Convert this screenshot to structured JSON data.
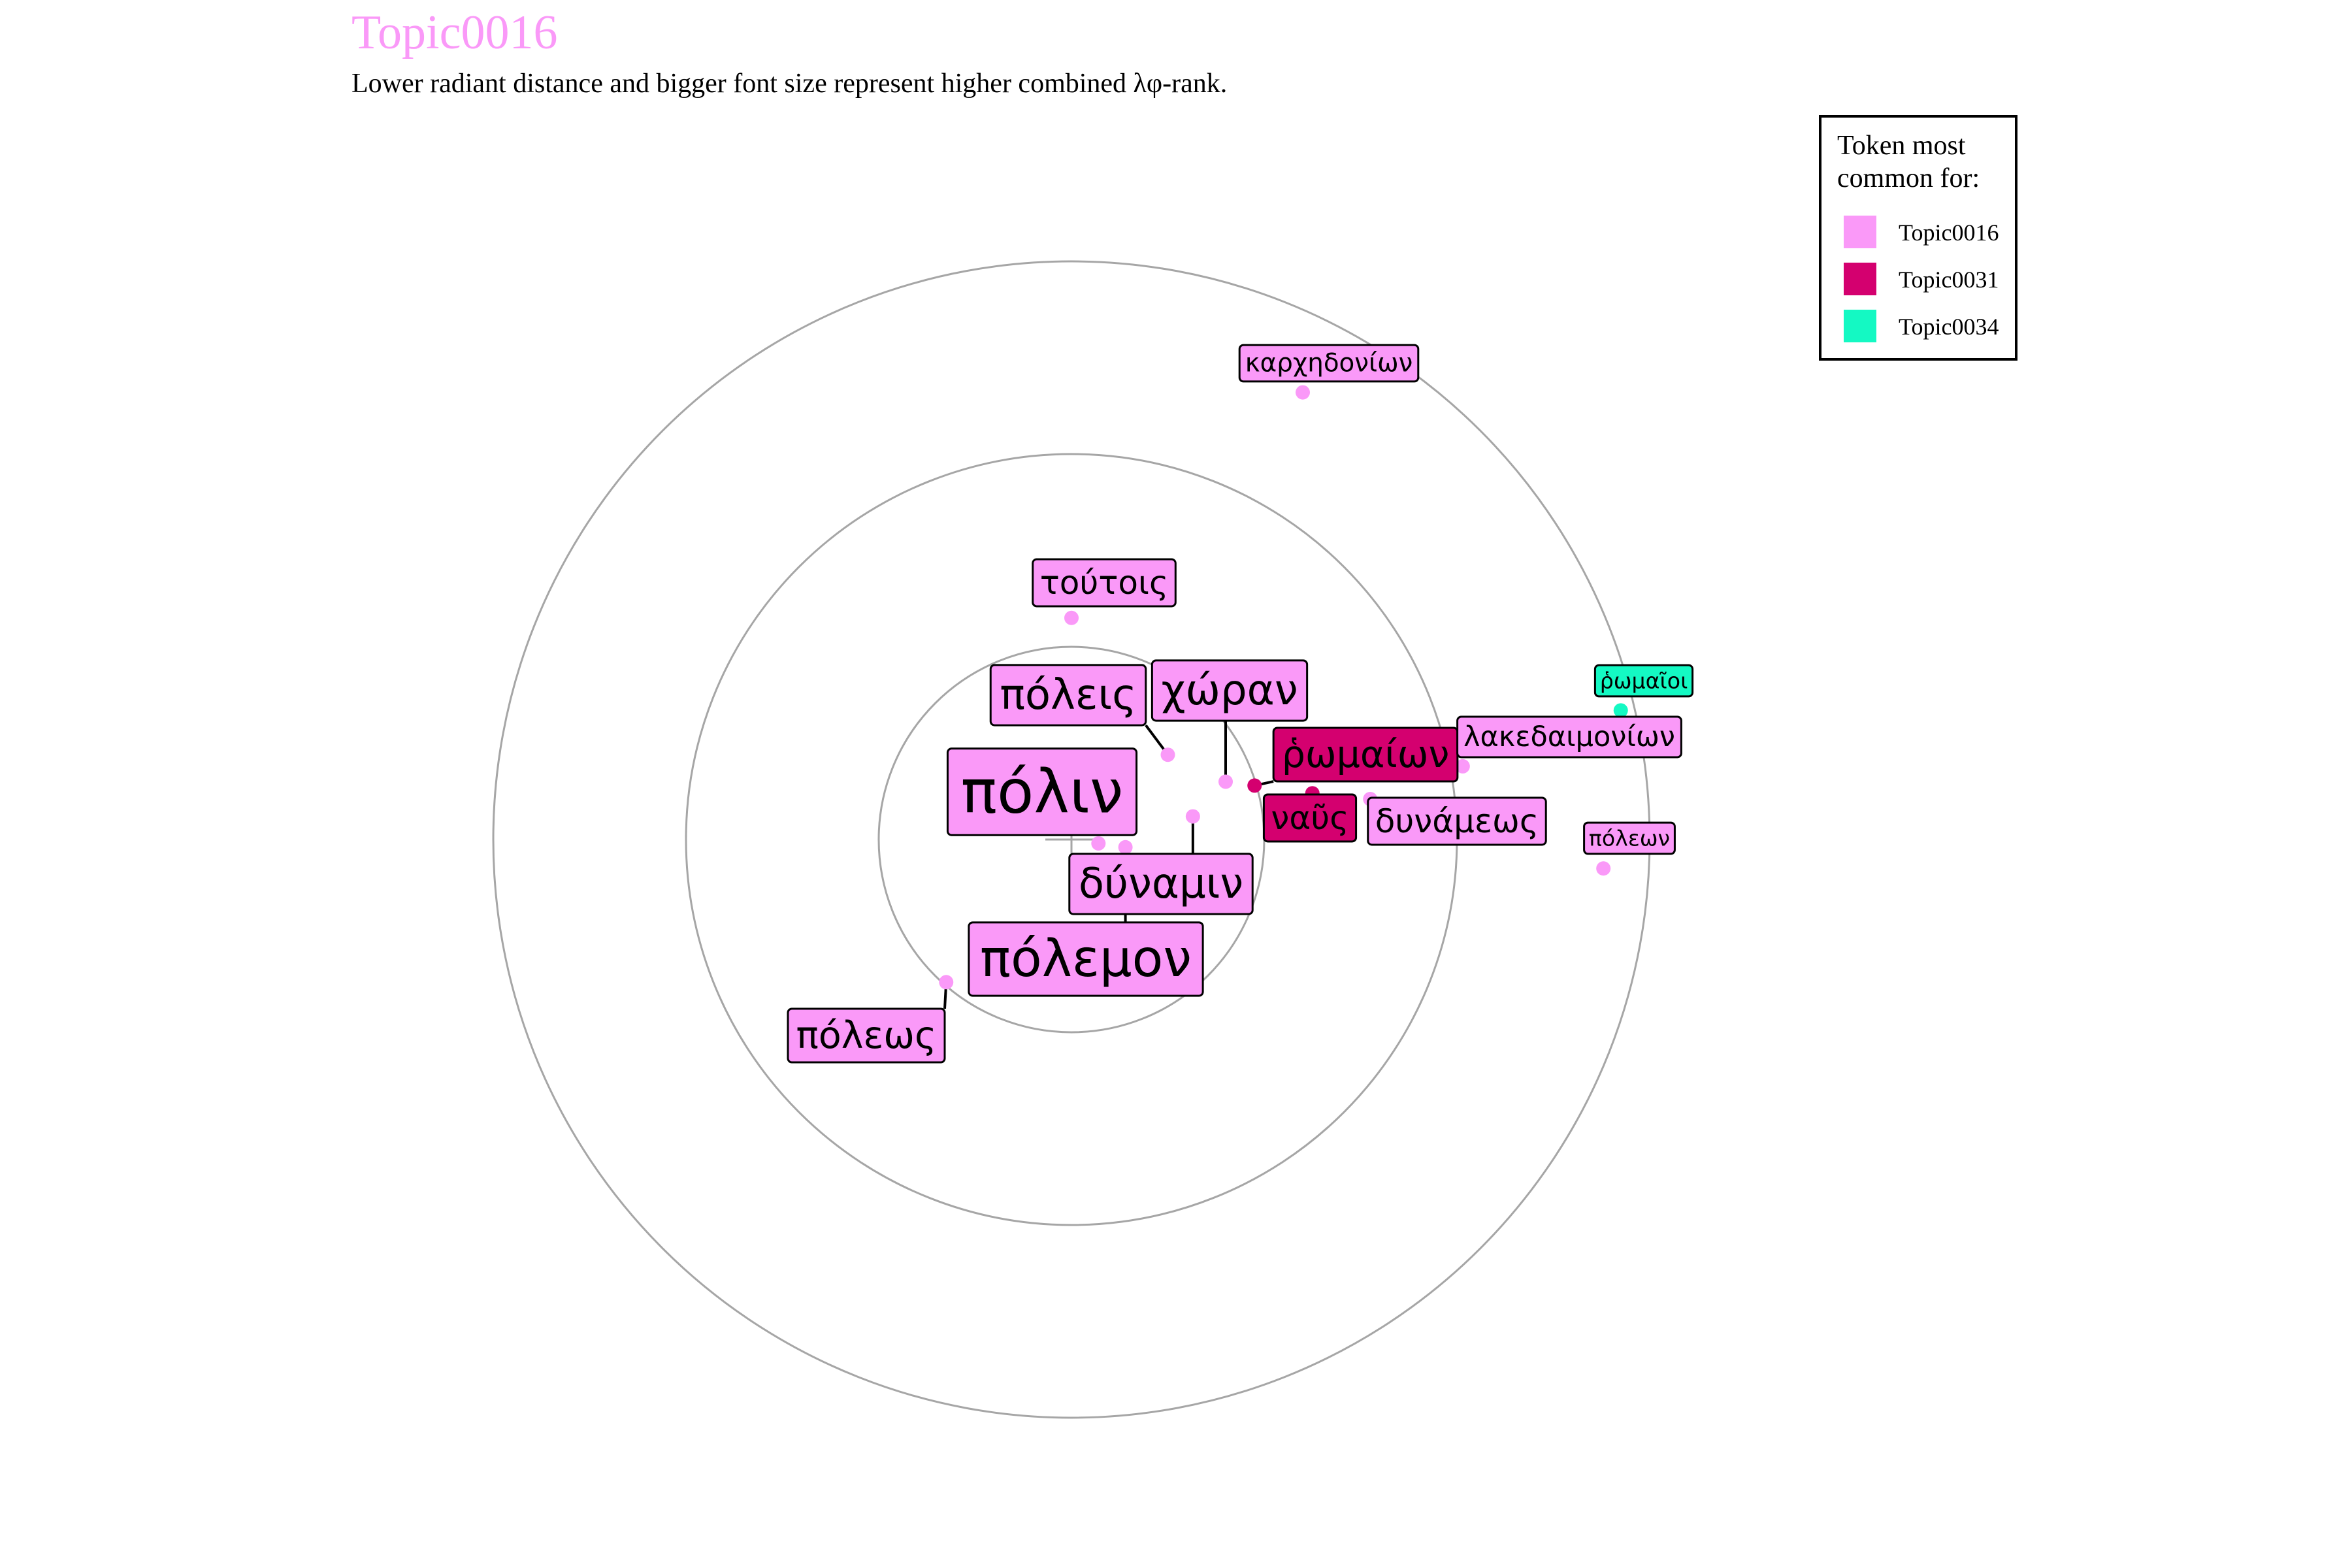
{
  "chart_data": {
    "type": "scatter",
    "title": "Topic0016",
    "subtitle": "Lower radiant distance and bigger font size represent higher combined λφ-rank.",
    "colors": {
      "Topic0016": "#FA99F8",
      "Topic0031": "#D4006F",
      "Topic0034": "#14F9C3",
      "title": "#FA99F8",
      "rings": "#A6A6A6",
      "center_cross": "#A6A6A6",
      "connector": "#000000",
      "label_border": "#000000"
    },
    "rings": [
      1,
      2,
      3
    ],
    "grid": true,
    "legend_position": "top-right",
    "legend": {
      "title": "Token most common for:",
      "entries": [
        {
          "label": "Topic0016",
          "color": "#FA99F8"
        },
        {
          "label": "Topic0031",
          "color": "#D4006F"
        },
        {
          "label": "Topic0034",
          "color": "#14F9C3"
        }
      ]
    },
    "points": [
      {
        "token": "πόλιν",
        "topic": "Topic0016",
        "x": 0.14,
        "y": -0.02,
        "label_size": 6
      },
      {
        "token": "πόλεμον",
        "topic": "Topic0016",
        "x": 0.28,
        "y": -0.04,
        "label_size": 5
      },
      {
        "token": "δύναμιν",
        "topic": "Topic0016",
        "x": 0.63,
        "y": 0.12,
        "label_size": 4
      },
      {
        "token": "χώραν",
        "topic": "Topic0016",
        "x": 0.8,
        "y": 0.3,
        "label_size": 4
      },
      {
        "token": "πόλεις",
        "topic": "Topic0016",
        "x": 0.5,
        "y": 0.44,
        "label_size": 4
      },
      {
        "token": "πόλεως",
        "topic": "Topic0016",
        "x": -0.65,
        "y": -0.74,
        "label_size": 3.5
      },
      {
        "token": "ῥωμαίων",
        "topic": "Topic0031",
        "x": 0.95,
        "y": 0.28,
        "label_size": 3.5
      },
      {
        "token": "ναῦς",
        "topic": "Topic0031",
        "x": 1.25,
        "y": 0.24,
        "label_size": 3
      },
      {
        "token": "τούτοις",
        "topic": "Topic0016",
        "x": 0.0,
        "y": 1.15,
        "label_size": 3
      },
      {
        "token": "δυνάμεως",
        "topic": "Topic0016",
        "x": 1.55,
        "y": 0.21,
        "label_size": 3
      },
      {
        "token": "λακεδαιμονίων",
        "topic": "Topic0016",
        "x": 2.03,
        "y": 0.38,
        "label_size": 2.5
      },
      {
        "token": "καρχηδονίων",
        "topic": "Topic0016",
        "x": 1.2,
        "y": 2.32,
        "label_size": 2.2
      },
      {
        "token": "ῥωμαῖοι",
        "topic": "Topic0034",
        "x": 2.85,
        "y": 0.67,
        "label_size": 1.8
      },
      {
        "token": "πόλεων",
        "topic": "Topic0016",
        "x": 2.76,
        "y": -0.15,
        "label_size": 1.8
      }
    ]
  }
}
